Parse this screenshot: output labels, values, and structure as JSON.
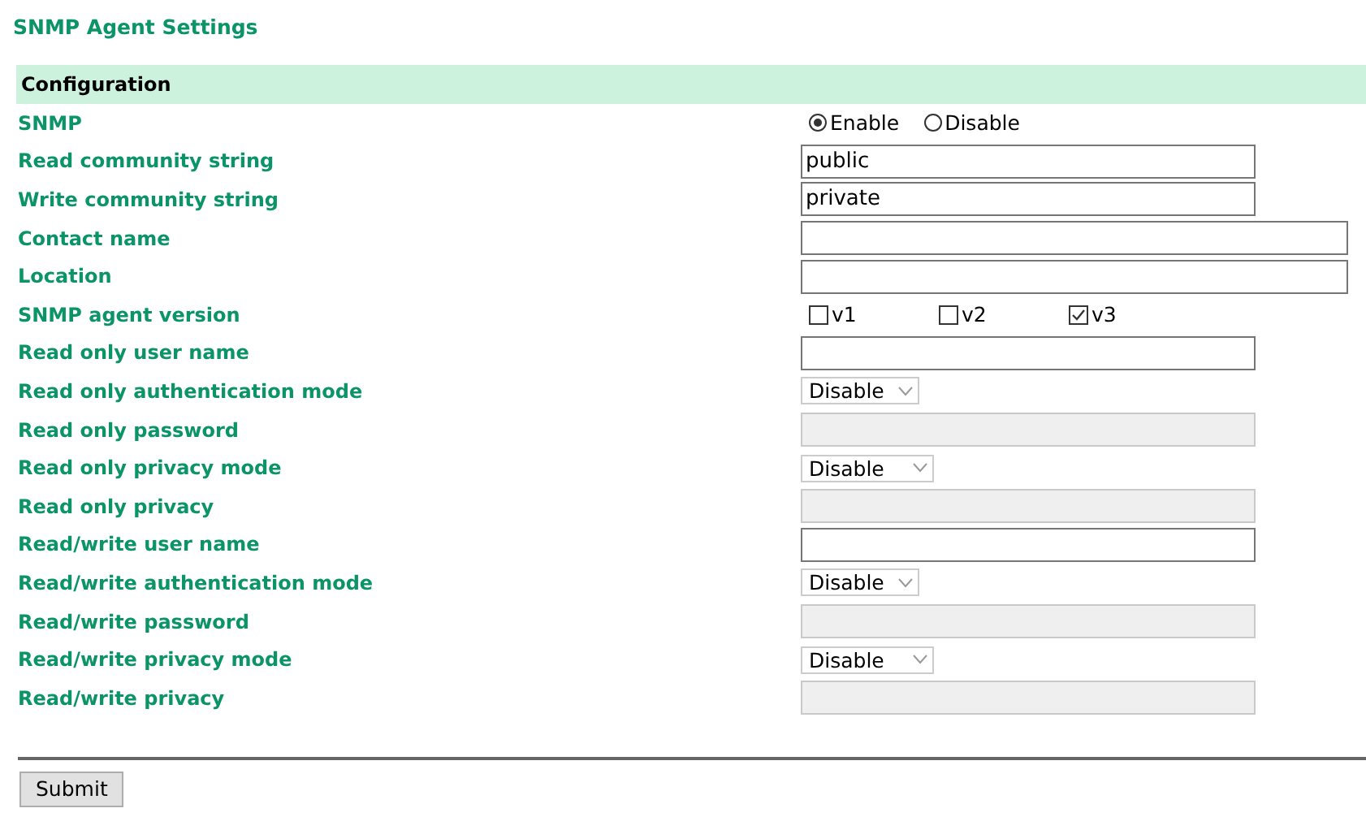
{
  "page_title": "SNMP Agent Settings",
  "section": "Configuration",
  "rows": [
    {
      "label": "SNMP",
      "kind": "radio",
      "options": [
        {
          "label": "Enable",
          "selected": true
        },
        {
          "label": "Disable",
          "selected": false
        }
      ]
    },
    {
      "label": "Read community string",
      "kind": "text",
      "value": "public",
      "wide": false,
      "disabled": false
    },
    {
      "label": "Write community string",
      "kind": "text",
      "value": "private",
      "wide": false,
      "disabled": false
    },
    {
      "label": "Contact name",
      "kind": "text",
      "wide": true,
      "disabled": false
    },
    {
      "label": "Location",
      "kind": "text",
      "wide": true,
      "disabled": false
    },
    {
      "label": "SNMP agent version",
      "kind": "checks",
      "options": [
        {
          "label": "v1",
          "checked": false
        },
        {
          "label": "v2",
          "checked": false
        },
        {
          "label": "v3",
          "checked": true
        }
      ]
    },
    {
      "label": "Read only user name",
      "kind": "text",
      "wide": false,
      "disabled": false
    },
    {
      "label": "Read only authentication mode",
      "kind": "select",
      "value": "Disable",
      "wide": false
    },
    {
      "label": "Read only password",
      "kind": "text",
      "wide": false,
      "disabled": true
    },
    {
      "label": "Read only privacy mode",
      "kind": "select",
      "value": "Disable",
      "wide": true
    },
    {
      "label": "Read only privacy",
      "kind": "text",
      "wide": false,
      "disabled": true
    },
    {
      "label": "Read/write user name",
      "kind": "text",
      "wide": false,
      "disabled": false
    },
    {
      "label": "Read/write authentication mode",
      "kind": "select",
      "value": "Disable",
      "wide": false
    },
    {
      "label": "Read/write password",
      "kind": "text",
      "wide": false,
      "disabled": true
    },
    {
      "label": "Read/write privacy mode",
      "kind": "select",
      "value": "Disable",
      "wide": true
    },
    {
      "label": "Read/write privacy",
      "kind": "text",
      "wide": false,
      "disabled": true
    }
  ],
  "submit": "Submit"
}
